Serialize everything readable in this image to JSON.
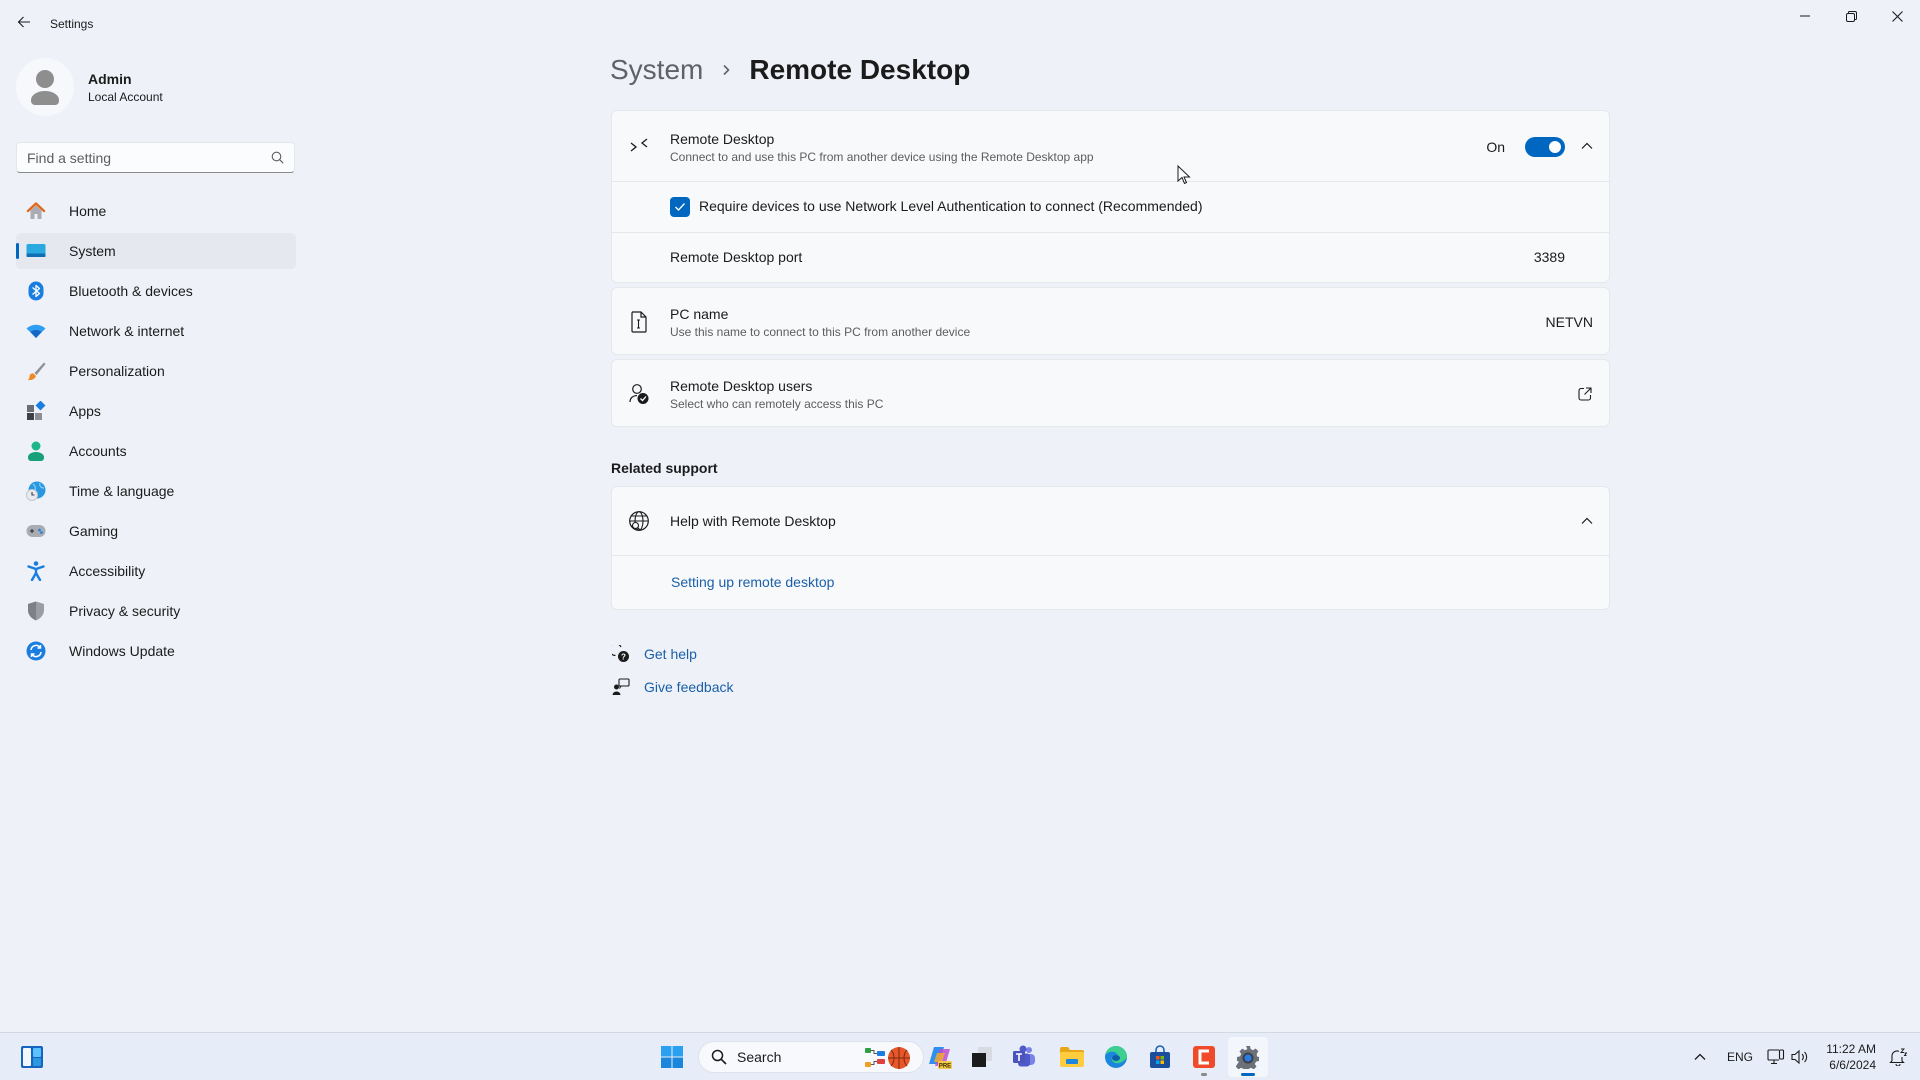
{
  "window": {
    "app_title": "Settings",
    "controls": [
      "minimize",
      "maximize",
      "close"
    ]
  },
  "profile": {
    "name": "Admin",
    "account_type": "Local Account"
  },
  "search": {
    "placeholder": "Find a setting",
    "value": ""
  },
  "sidebar": {
    "items": [
      {
        "label": "Home",
        "icon": "home-icon",
        "active": false
      },
      {
        "label": "System",
        "icon": "system-icon",
        "active": true
      },
      {
        "label": "Bluetooth & devices",
        "icon": "bluetooth-icon",
        "active": false
      },
      {
        "label": "Network & internet",
        "icon": "wifi-icon",
        "active": false
      },
      {
        "label": "Personalization",
        "icon": "brush-icon",
        "active": false
      },
      {
        "label": "Apps",
        "icon": "apps-icon",
        "active": false
      },
      {
        "label": "Accounts",
        "icon": "person-icon",
        "active": false
      },
      {
        "label": "Time & language",
        "icon": "globe-clock-icon",
        "active": false
      },
      {
        "label": "Gaming",
        "icon": "gamepad-icon",
        "active": false
      },
      {
        "label": "Accessibility",
        "icon": "accessibility-icon",
        "active": false
      },
      {
        "label": "Privacy & security",
        "icon": "shield-icon",
        "active": false
      },
      {
        "label": "Windows Update",
        "icon": "update-icon",
        "active": false
      }
    ]
  },
  "breadcrumb": {
    "parent": "System",
    "current": "Remote Desktop"
  },
  "remote_desktop": {
    "title": "Remote Desktop",
    "description": "Connect to and use this PC from another device using the Remote Desktop app",
    "toggle_label": "On",
    "enabled": true,
    "expanded": true,
    "nla_label": "Require devices to use Network Level Authentication to connect (Recommended)",
    "nla_checked": true,
    "port_label": "Remote Desktop port",
    "port_value": "3389"
  },
  "pc_name": {
    "title": "PC name",
    "description": "Use this name to connect to this PC from another device",
    "value": "NETVN"
  },
  "rd_users": {
    "title": "Remote Desktop users",
    "description": "Select who can remotely access this PC"
  },
  "related_support": {
    "heading": "Related support",
    "help_title": "Help with Remote Desktop",
    "expanded": true,
    "links": [
      "Setting up remote desktop"
    ]
  },
  "footer_links": {
    "get_help": "Get help",
    "give_feedback": "Give feedback"
  },
  "taskbar": {
    "search_label": "Search",
    "pinned": [
      "start",
      "widgets",
      "copilot",
      "app-black-square",
      "teams",
      "file-explorer",
      "edge",
      "microsoft-store",
      "red-app",
      "settings"
    ],
    "tray": {
      "language": "ENG",
      "time": "11:22 AM",
      "date": "6/6/2024"
    }
  },
  "colors": {
    "accent": "#0067c0",
    "link": "#1a5fa8",
    "background": "#eef2f8",
    "card": "#f8f9fb"
  }
}
